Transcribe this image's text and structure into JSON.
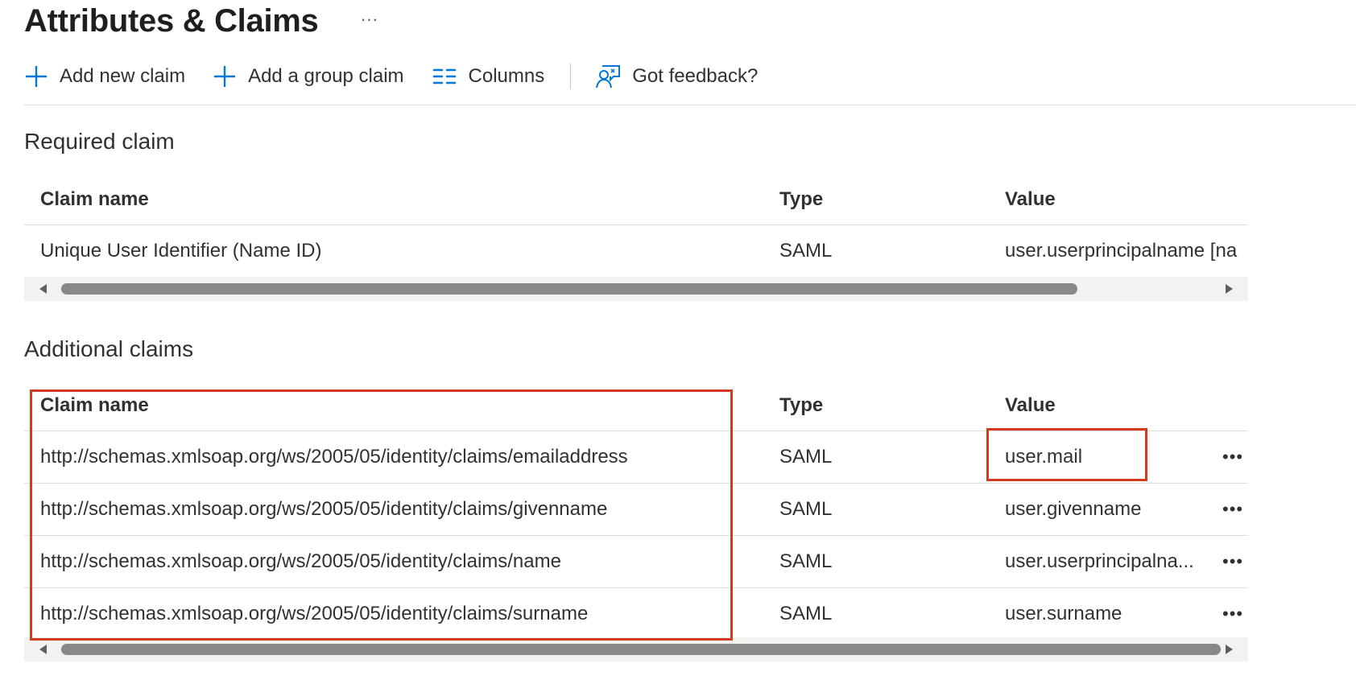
{
  "page": {
    "title": "Attributes & Claims",
    "more_label": "···"
  },
  "toolbar": {
    "add_claim": {
      "label": "Add new claim",
      "icon": "plus-icon"
    },
    "add_group_claim": {
      "label": "Add a group claim",
      "icon": "plus-icon"
    },
    "columns": {
      "label": "Columns",
      "icon": "columns-icon"
    },
    "feedback": {
      "label": "Got feedback?",
      "icon": "feedback-icon"
    }
  },
  "required": {
    "title": "Required claim",
    "headers": {
      "name": "Claim name",
      "type": "Type",
      "value": "Value"
    },
    "rows": [
      {
        "name": "Unique User Identifier (Name ID)",
        "type": "SAML",
        "value": "user.userprincipalname [na"
      }
    ]
  },
  "additional": {
    "title": "Additional claims",
    "headers": {
      "name": "Claim name",
      "type": "Type",
      "value": "Value"
    },
    "rows": [
      {
        "name": "http://schemas.xmlsoap.org/ws/2005/05/identity/claims/emailaddress",
        "type": "SAML",
        "value": "user.mail",
        "more": "•••"
      },
      {
        "name": "http://schemas.xmlsoap.org/ws/2005/05/identity/claims/givenname",
        "type": "SAML",
        "value": "user.givenname",
        "more": "•••"
      },
      {
        "name": "http://schemas.xmlsoap.org/ws/2005/05/identity/claims/name",
        "type": "SAML",
        "value": "user.userprincipalna...",
        "more": "•••"
      },
      {
        "name": "http://schemas.xmlsoap.org/ws/2005/05/identity/claims/surname",
        "type": "SAML",
        "value": "user.surname",
        "more": "•••"
      }
    ]
  },
  "colors": {
    "accent": "#0078d4",
    "highlight": "#d13c1f",
    "scroll_thumb": "#8a8886",
    "scroll_track": "#f3f2f1"
  }
}
